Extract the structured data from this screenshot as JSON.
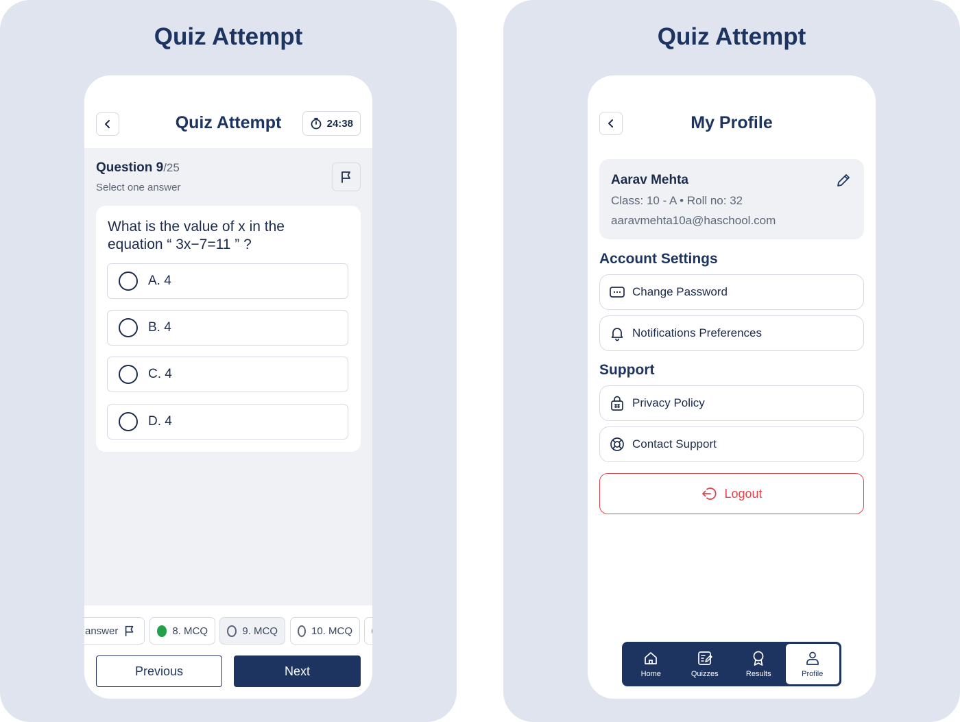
{
  "left_panel": {
    "title": "Quiz Attempt",
    "screen": {
      "title": "Quiz Attempt",
      "timer": "24:38",
      "question_label": "Question 9",
      "question_total": "/25",
      "hint": "Select one answer",
      "question_text": "What is the value of x in the equation “ 3x−7=11 ” ?",
      "options": [
        {
          "label": "A. 4",
          "selected": false
        },
        {
          "label": "B. 4",
          "selected": false
        },
        {
          "label": "C. 4",
          "selected": false
        },
        {
          "label": "D. 4",
          "selected": false
        }
      ],
      "navigator": [
        {
          "label": "answer",
          "status": "flagged"
        },
        {
          "label": "8. MCQ",
          "status": "answered"
        },
        {
          "label": "9. MCQ",
          "status": "current"
        },
        {
          "label": "10. MCQ",
          "status": "unanswered"
        }
      ],
      "previous_label": "Previous",
      "next_label": "Next"
    }
  },
  "right_panel": {
    "title": "Quiz Attempt",
    "screen": {
      "title": "My Profile",
      "profile": {
        "name": "Aarav Mehta",
        "meta": "Class: 10 - A • Roll no: 32",
        "email": "aaravmehta10a@haschool.com"
      },
      "account_settings_title": "Account Settings",
      "account_settings": [
        {
          "label": "Change Password",
          "icon": "password-icon"
        },
        {
          "label": "Notifications Preferences",
          "icon": "bell-icon"
        }
      ],
      "support_title": "Support",
      "support": [
        {
          "label": "Privacy Policy",
          "icon": "lock-icon"
        },
        {
          "label": "Contact Support",
          "icon": "lifebuoy-icon"
        }
      ],
      "logout_label": "Logout",
      "nav": [
        {
          "label": "Home",
          "icon": "home-icon",
          "active": false
        },
        {
          "label": "Quizzes",
          "icon": "quizzes-icon",
          "active": false
        },
        {
          "label": "Results",
          "icon": "results-icon",
          "active": false
        },
        {
          "label": "Profile",
          "icon": "profile-icon",
          "active": true
        }
      ]
    }
  },
  "colors": {
    "primary": "#1d3461",
    "panel_bg": "#dfe4ee",
    "body_bg": "#eff1f4",
    "answered": "#22a04b",
    "danger": "#e0474c"
  }
}
